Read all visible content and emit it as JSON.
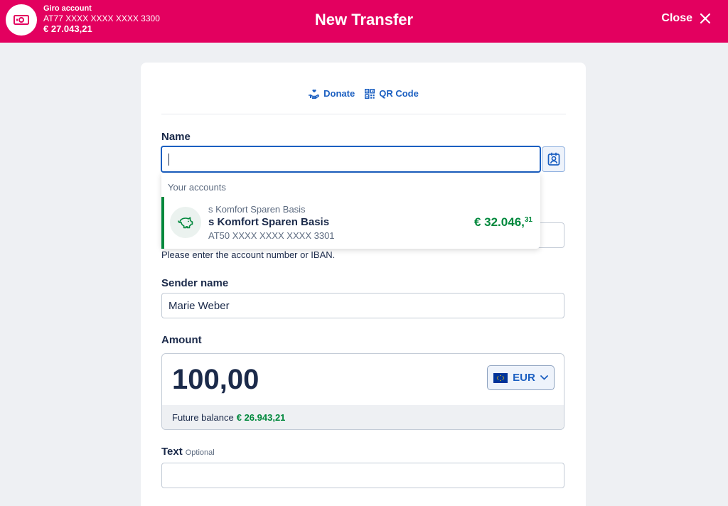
{
  "header": {
    "account_name": "Giro account",
    "account_iban": "AT77 XXXX XXXX XXXX 3300",
    "account_balance": "€ 27.043,21",
    "title": "New Transfer",
    "close_label": "Close",
    "accent_color": "#e3005f",
    "account_icon": "banknote-icon",
    "close_icon": "close-icon"
  },
  "actions": {
    "donate_label": "Donate",
    "donate_icon": "hand-heart-icon",
    "qr_label": "QR Code",
    "qr_icon": "qr-code-icon"
  },
  "name_field": {
    "label": "Name",
    "value": "",
    "contact_icon": "contact-book-icon"
  },
  "suggestions": {
    "header": "Your accounts",
    "items": [
      {
        "subtitle": "s Komfort Sparen Basis",
        "title": "s Komfort Sparen Basis",
        "iban": "AT50 XXXX XXXX XXXX 3301",
        "amount_main": "€ 32.046,",
        "amount_cents": "31",
        "icon": "piggy-bank-icon",
        "accent_color": "#00883c"
      }
    ]
  },
  "iban_field": {
    "helper": "Please enter the account number or IBAN."
  },
  "sender": {
    "label": "Sender name",
    "value": "Marie Weber"
  },
  "amount": {
    "label": "Amount",
    "value": "100,00",
    "currency": "EUR",
    "currency_icon": "eu-flag-icon",
    "future_label": "Future balance",
    "future_value": "€ 26.943,21"
  },
  "text_field": {
    "label": "Text",
    "optional": "Optional",
    "value": ""
  }
}
